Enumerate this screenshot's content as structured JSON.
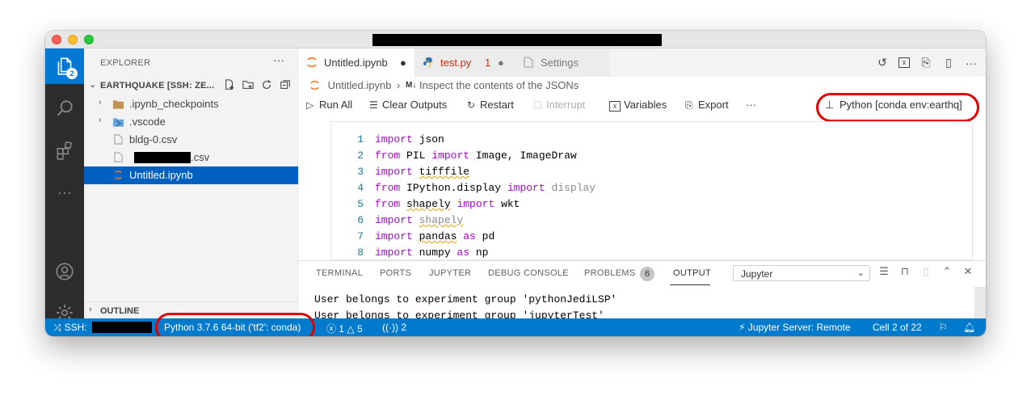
{
  "sidebar": {
    "title": "EXPLORER",
    "more": "···",
    "folder": "EARTHQUAKE [SSH: ZE...",
    "items": [
      {
        "label": ".ipynb_checkpoints",
        "type": "folder"
      },
      {
        "label": ".vscode",
        "type": "folder"
      },
      {
        "label": "bldg-0.csv",
        "type": "file"
      },
      {
        "label": ".csv",
        "type": "file"
      },
      {
        "label": "Untitled.ipynb",
        "type": "notebook"
      }
    ],
    "outline": "OUTLINE",
    "activity_badge": "2"
  },
  "tabs": [
    {
      "label": "Untitled.ipynb",
      "dirty": "●"
    },
    {
      "label": "test.py",
      "errors": "1",
      "dirty": "●"
    },
    {
      "label": "Settings"
    }
  ],
  "breadcrumb": {
    "file": "Untitled.ipynb",
    "cell": "Inspect the contents of the JSONs",
    "cell_kind": "M↓"
  },
  "toolbar": {
    "run_all": "Run All",
    "clear_outputs": "Clear Outputs",
    "restart": "Restart",
    "interrupt": "Interrupt",
    "variables": "Variables",
    "export": "Export",
    "more": "···",
    "kernel": "Python [conda env:earthq]"
  },
  "code": [
    {
      "n": "1",
      "tokens": [
        [
          "kw",
          "import"
        ],
        [
          "",
          " json"
        ]
      ]
    },
    {
      "n": "2",
      "tokens": [
        [
          "kw",
          "from"
        ],
        [
          "",
          " PIL "
        ],
        [
          "kw",
          "import"
        ],
        [
          "",
          " Image, ImageDraw"
        ]
      ]
    },
    {
      "n": "3",
      "tokens": [
        [
          "kw",
          "import"
        ],
        [
          "",
          " "
        ],
        [
          "sq",
          "tifffile"
        ]
      ]
    },
    {
      "n": "4",
      "tokens": [
        [
          "kw",
          "from"
        ],
        [
          "",
          " IPython.display "
        ],
        [
          "kw",
          "import"
        ],
        [
          "dim",
          " display"
        ]
      ]
    },
    {
      "n": "5",
      "tokens": [
        [
          "kw",
          "from"
        ],
        [
          "",
          " "
        ],
        [
          "sq",
          "shapely"
        ],
        [
          "",
          " "
        ],
        [
          "kw",
          "import"
        ],
        [
          "",
          " wkt"
        ]
      ]
    },
    {
      "n": "6",
      "tokens": [
        [
          "kw",
          "import"
        ],
        [
          "",
          " "
        ],
        [
          "dimsq",
          "shapely"
        ]
      ]
    },
    {
      "n": "7",
      "tokens": [
        [
          "kw",
          "import"
        ],
        [
          "",
          " "
        ],
        [
          "sq",
          "pandas"
        ],
        [
          "",
          " "
        ],
        [
          "kw",
          "as"
        ],
        [
          "",
          " pd"
        ]
      ]
    },
    {
      "n": "8",
      "tokens": [
        [
          "kw",
          "import"
        ],
        [
          "",
          " numpy "
        ],
        [
          "kw",
          "as"
        ],
        [
          "",
          " np"
        ]
      ]
    }
  ],
  "panel": {
    "tabs": [
      "TERMINAL",
      "PORTS",
      "JUPYTER",
      "DEBUG CONSOLE",
      "PROBLEMS",
      "OUTPUT"
    ],
    "problems_count": "6",
    "output_channel": "Jupyter",
    "lines": [
      "User belongs to experiment group 'pythonJediLSP'",
      "User belongs to experiment group 'jupyterTest'"
    ]
  },
  "status": {
    "remote": "SSH:",
    "interpreter": "Python 3.7.6 64-bit ('tf2': conda)",
    "errors": "1",
    "warnings": "5",
    "ports": "2",
    "jupyter_server": "Jupyter Server: Remote",
    "cell": "Cell 2 of 22"
  },
  "colors": {
    "accent": "#007acc",
    "selection": "#0060c0",
    "highlight": "#e00000"
  }
}
